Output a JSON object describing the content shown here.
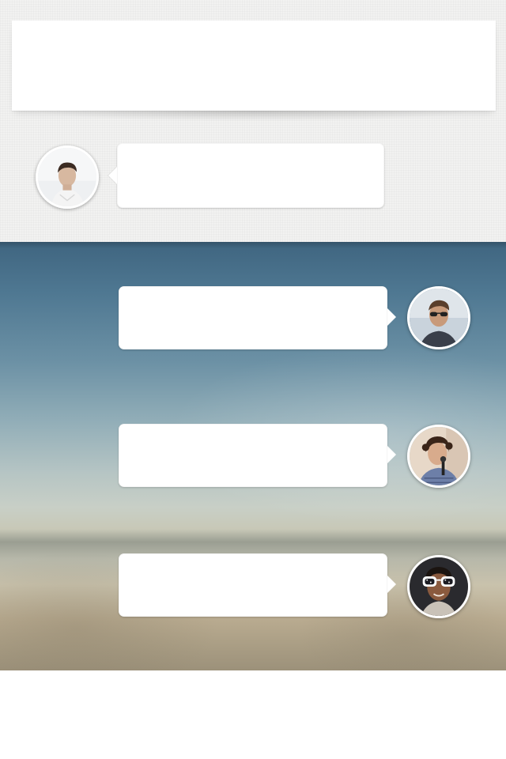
{
  "header": {
    "title": ""
  },
  "messages": [
    {
      "sender": "",
      "avatar_icon": "user-avatar-1",
      "text": ""
    },
    {
      "sender": "",
      "avatar_icon": "user-avatar-2",
      "text": ""
    },
    {
      "sender": "",
      "avatar_icon": "user-avatar-3",
      "text": ""
    },
    {
      "sender": "",
      "avatar_icon": "user-avatar-4",
      "text": ""
    }
  ],
  "colors": {
    "background_top": "#f2f2f1",
    "bubble": "#ffffff",
    "avatar_border": "#ffffff",
    "photo_sky": "#4f7892",
    "photo_sand": "#b9ab90"
  }
}
